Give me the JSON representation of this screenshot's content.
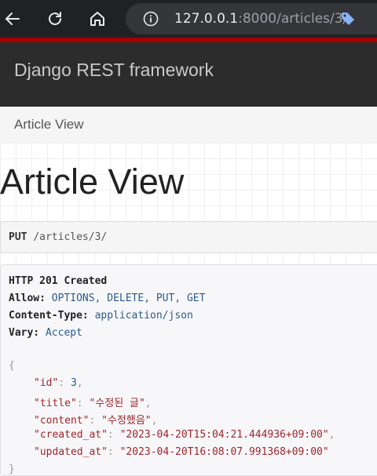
{
  "browser": {
    "url_host": "127.0.0.1",
    "url_rest": ":8000/articles/3/"
  },
  "navbar": {
    "brand": "Django REST framework"
  },
  "breadcrumb": {
    "current": "Article View"
  },
  "page": {
    "title": "Article View"
  },
  "request": {
    "method": "PUT",
    "path": "/articles/3/"
  },
  "response": {
    "status": "HTTP 201 Created",
    "headers": [
      {
        "key": "Allow:",
        "value": "OPTIONS, DELETE, PUT, GET"
      },
      {
        "key": "Content-Type:",
        "value": "application/json"
      },
      {
        "key": "Vary:",
        "value": "Accept"
      }
    ],
    "json_open": "{",
    "json_close": "}",
    "fields": [
      {
        "key": "\"id\"",
        "value": "3",
        "type": "num",
        "comma": ","
      },
      {
        "key": "\"title\"",
        "value": "\"수정된 글\"",
        "type": "str",
        "comma": ","
      },
      {
        "key": "\"content\"",
        "value": "\"수정했음\"",
        "type": "str",
        "comma": ","
      },
      {
        "key": "\"created_at\"",
        "value": "\"2023-04-20T15:04:21.444936+09:00\"",
        "type": "str",
        "comma": ","
      },
      {
        "key": "\"updated_at\"",
        "value": "\"2023-04-20T16:08:07.991368+09:00\"",
        "type": "str",
        "comma": ""
      }
    ]
  }
}
